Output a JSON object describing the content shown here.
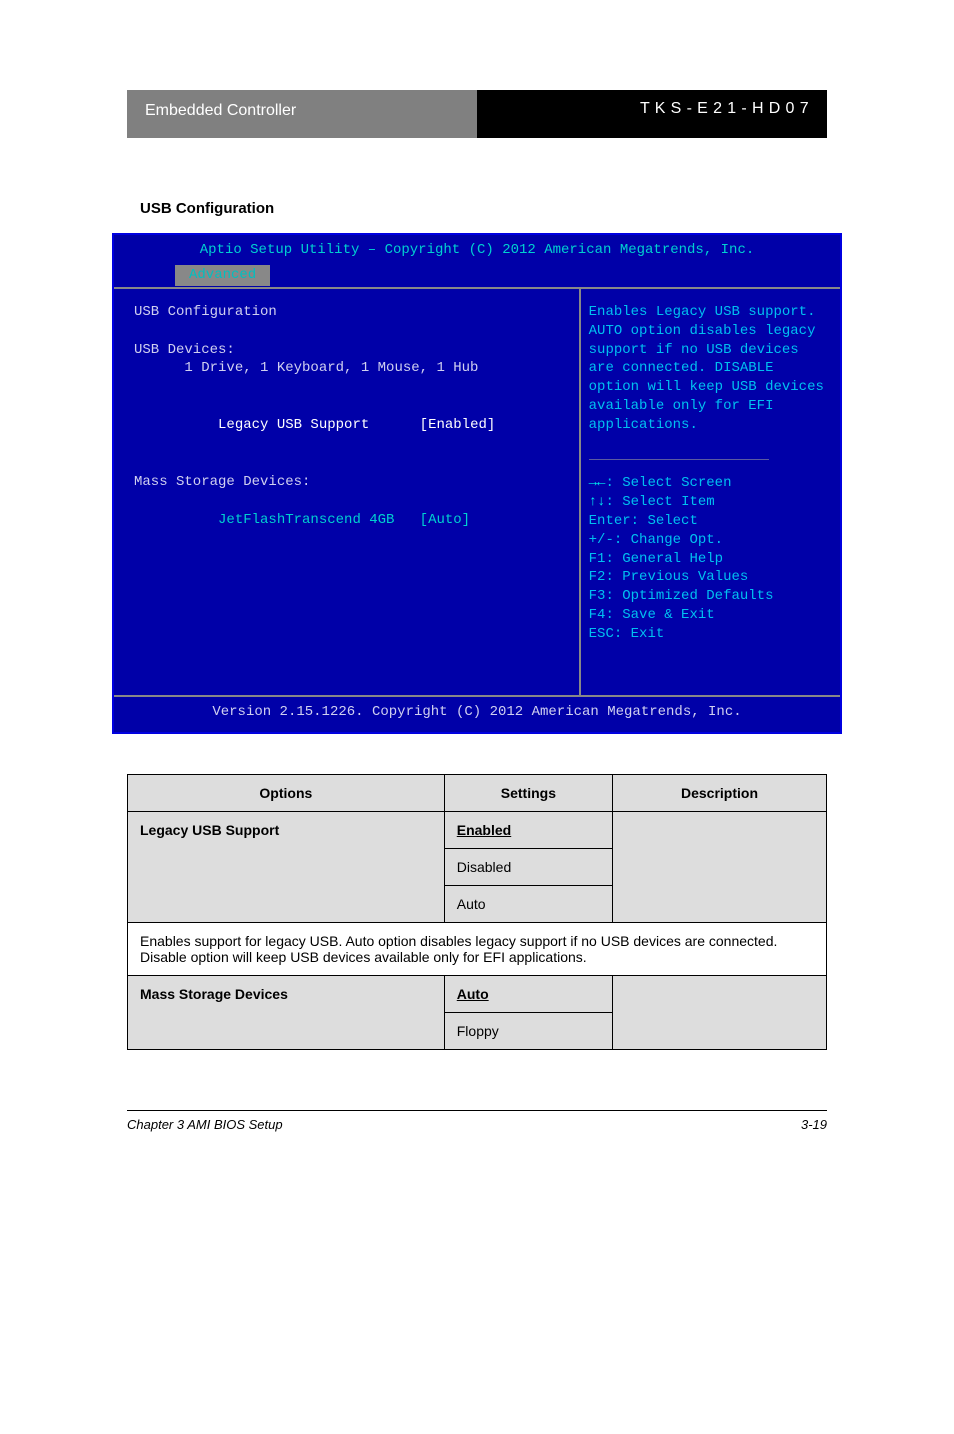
{
  "header": {
    "left": "Embedded Controller",
    "right": "T K S - E 2 1 - H D 0 7"
  },
  "label_usb": "USB Configuration",
  "bios": {
    "title": "Aptio Setup Utility – Copyright (C) 2012 American Megatrends, Inc.",
    "tab": "Advanced",
    "left": {
      "heading": "USB Configuration",
      "devices_label": "USB Devices:",
      "devices_line": "      1 Drive, 1 Keyboard, 1 Mouse, 1 Hub",
      "legacy_label": "Legacy USB Support",
      "legacy_value": "[Enabled]",
      "mass_label": "Mass Storage Devices:",
      "mass_device": "JetFlashTranscend 4GB",
      "mass_value": "[Auto]"
    },
    "right": {
      "help": "Enables Legacy USB support. AUTO option disables legacy support if no USB devices are connected. DISABLE option will keep USB devices available only for EFI applications.",
      "keys": {
        "screen": ": Select Screen",
        "item": ": Select Item",
        "enter": "Enter: Select",
        "change": "+/-: Change Opt.",
        "f1": "F1: General Help",
        "f2": "F2: Previous Values",
        "f3": "F3: Optimized Defaults",
        "f4": "F4: Save & Exit",
        "esc": "ESC: Exit"
      }
    },
    "footer": "Version 2.15.1226. Copyright (C) 2012 American Megatrends, Inc."
  },
  "table": {
    "head": [
      "Options",
      "Settings",
      "Description"
    ],
    "rows": [
      {
        "name": "Legacy USB Support",
        "values": [
          "Enabled",
          "Disabled",
          "Auto"
        ],
        "default_index": 0,
        "desc": " ",
        "long_desc": "Enables support for legacy USB. Auto option disables legacy support if no USB devices are connected. Disable option will keep USB devices available only for EFI applications."
      },
      {
        "name": "Mass Storage Devices",
        "values": [
          "Auto",
          "Floppy"
        ],
        "default_index": 0,
        "desc": " "
      }
    ]
  },
  "footer": {
    "left": "Chapter 3 AMI BIOS Setup",
    "right": "3-19"
  }
}
